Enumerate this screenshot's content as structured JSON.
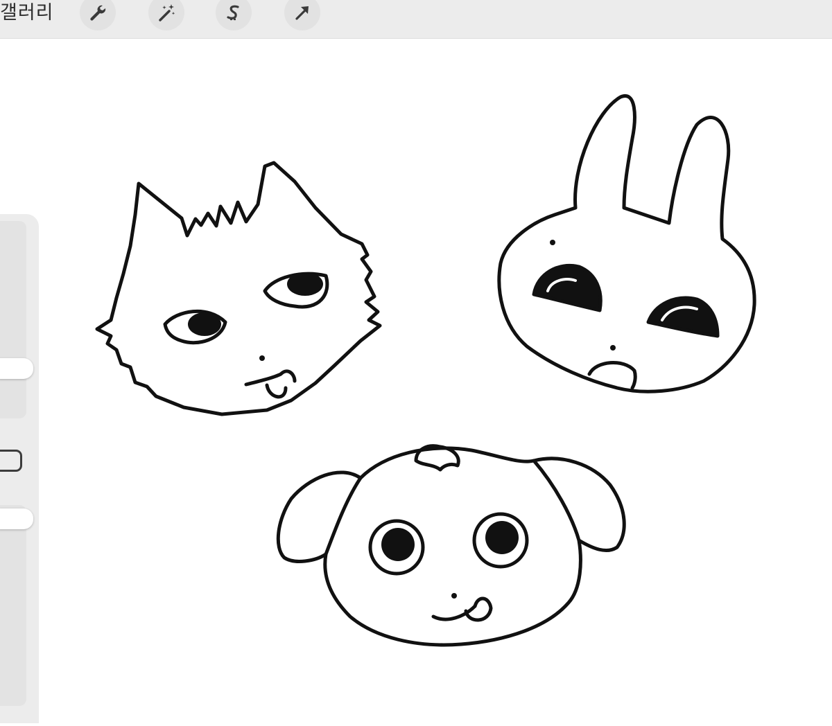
{
  "topbar": {
    "gallery_label": "갤러리",
    "tools": [
      {
        "icon": "wrench-icon"
      },
      {
        "icon": "magic-wand-icon"
      },
      {
        "icon": "selection-icon"
      },
      {
        "icon": "arrow-icon"
      }
    ]
  },
  "sidebar": {
    "brush_size_slider": {
      "level": 0.6
    },
    "opacity_slider": {
      "level": 0.97
    },
    "modify_button": {
      "icon": "square-icon"
    }
  },
  "canvas": {
    "drawings": [
      "cat-face",
      "rabbit-face",
      "puppy-face"
    ]
  },
  "colors": {
    "toolbar_bg": "#ececec",
    "canvas_bg": "#ffffff",
    "ink": "#111111"
  }
}
